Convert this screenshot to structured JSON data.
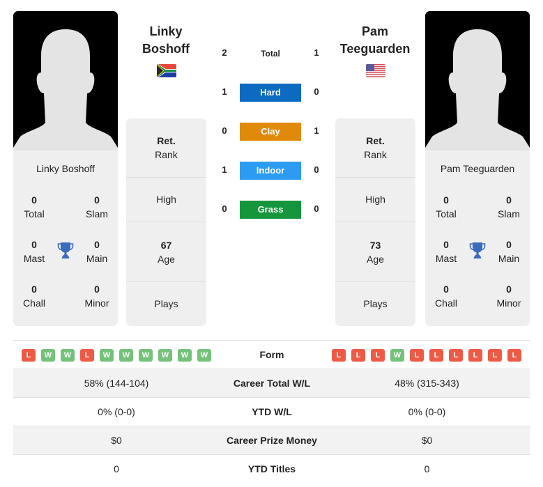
{
  "colors": {
    "hard": "#0c6bc0",
    "clay": "#e08a0c",
    "indoor": "#2c9cf2",
    "grass": "#15963c",
    "win": "#74c27a",
    "loss": "#ee5a45",
    "trophy": "#3a6bbd"
  },
  "player_left": {
    "header_first": "Linky",
    "header_last": "Boshoff",
    "flag": "south-africa-flag",
    "card_name": "Linky Boshoff",
    "titles": {
      "total": {
        "value": "0",
        "label": "Total"
      },
      "slam": {
        "value": "0",
        "label": "Slam"
      },
      "mast": {
        "value": "0",
        "label": "Mast"
      },
      "main": {
        "value": "0",
        "label": "Main"
      },
      "chall": {
        "value": "0",
        "label": "Chall"
      },
      "minor": {
        "value": "0",
        "label": "Minor"
      }
    },
    "info": {
      "rank_value": "Ret.",
      "rank_label": "Rank",
      "high_label": "High",
      "age_value": "67",
      "age_label": "Age",
      "plays_label": "Plays"
    },
    "form": [
      "L",
      "W",
      "W",
      "L",
      "W",
      "W",
      "W",
      "W",
      "W",
      "W"
    ]
  },
  "player_right": {
    "header_first": "Pam",
    "header_last": "Teeguarden",
    "flag": "usa-flag",
    "card_name": "Pam Teeguarden",
    "titles": {
      "total": {
        "value": "0",
        "label": "Total"
      },
      "slam": {
        "value": "0",
        "label": "Slam"
      },
      "mast": {
        "value": "0",
        "label": "Mast"
      },
      "main": {
        "value": "0",
        "label": "Main"
      },
      "chall": {
        "value": "0",
        "label": "Chall"
      },
      "minor": {
        "value": "0",
        "label": "Minor"
      }
    },
    "info": {
      "rank_value": "Ret.",
      "rank_label": "Rank",
      "high_label": "High",
      "age_value": "73",
      "age_label": "Age",
      "plays_label": "Plays"
    },
    "form": [
      "L",
      "L",
      "L",
      "W",
      "L",
      "L",
      "L",
      "L",
      "L",
      "L"
    ]
  },
  "h2h": [
    {
      "label": "Total",
      "left": "2",
      "right": "1",
      "style": "plain"
    },
    {
      "label": "Hard",
      "left": "1",
      "right": "0",
      "style": "hard"
    },
    {
      "label": "Clay",
      "left": "0",
      "right": "1",
      "style": "clay"
    },
    {
      "label": "Indoor",
      "left": "1",
      "right": "0",
      "style": "indoor"
    },
    {
      "label": "Grass",
      "left": "0",
      "right": "0",
      "style": "grass"
    }
  ],
  "comparison": {
    "form_label": "Form",
    "rows": [
      {
        "label": "Career Total W/L",
        "left": "58% (144-104)",
        "right": "48% (315-343)"
      },
      {
        "label": "YTD W/L",
        "left": "0% (0-0)",
        "right": "0% (0-0)"
      },
      {
        "label": "Career Prize Money",
        "left": "$0",
        "right": "$0"
      },
      {
        "label": "YTD Titles",
        "left": "0",
        "right": "0"
      }
    ]
  }
}
